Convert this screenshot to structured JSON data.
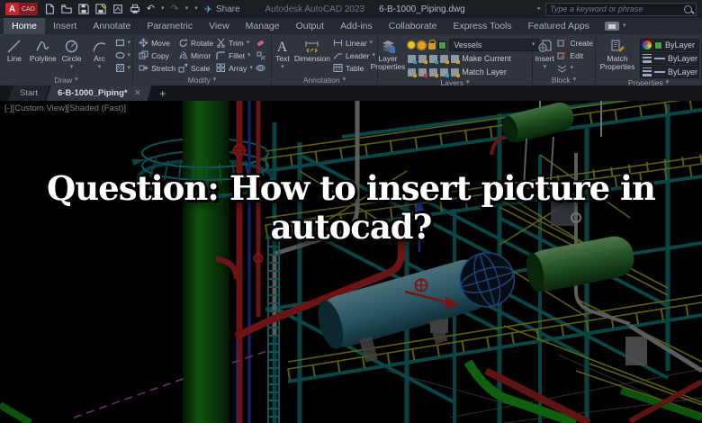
{
  "title_bar": {
    "logo_a": "A",
    "logo_cad": "CAD",
    "app_title": "Autodesk AutoCAD 2023",
    "doc_title": "6-B-1000_Piping.dwg",
    "share_label": "Share",
    "search_placeholder": "Type a keyword or phrase"
  },
  "glyphs": {
    "caret_down": "▾",
    "caret_right": "▸",
    "undo": "↶",
    "redo": "↷",
    "share_plane": "✈",
    "close": "✕",
    "plus": "+"
  },
  "ribbon": {
    "tabs": [
      {
        "label": "Home",
        "active": true
      },
      {
        "label": "Insert"
      },
      {
        "label": "Annotate"
      },
      {
        "label": "Parametric"
      },
      {
        "label": "View"
      },
      {
        "label": "Manage"
      },
      {
        "label": "Output"
      },
      {
        "label": "Add-ins"
      },
      {
        "label": "Collaborate"
      },
      {
        "label": "Express Tools"
      },
      {
        "label": "Featured Apps"
      }
    ],
    "draw": {
      "label": "Draw",
      "tools": [
        {
          "label": "Line"
        },
        {
          "label": "Polyline"
        },
        {
          "label": "Circle"
        },
        {
          "label": "Arc"
        }
      ]
    },
    "modify": {
      "label": "Modify",
      "col1": [
        "Move",
        "Copy",
        "Stretch"
      ],
      "col2": [
        "Rotate",
        "Mirror",
        "Scale"
      ],
      "col3": [
        "Trim",
        "Fillet",
        "Array"
      ]
    },
    "annotation": {
      "label": "Annotation",
      "text_label": "Text",
      "dimension_label": "Dimension",
      "rows": [
        "Linear",
        "Leader",
        "Table"
      ]
    },
    "layers": {
      "label": "Layers",
      "layer_properties_1": "Layer",
      "layer_properties_2": "Properties",
      "current_layer": "Vessels",
      "make_current": "Make Current",
      "match_layer": "Match Layer"
    },
    "block": {
      "label": "Block",
      "insert_label": "Insert",
      "rows": [
        "Create",
        "Edit"
      ]
    },
    "properties": {
      "label": "Properties",
      "match_1": "Match",
      "match_2": "Properties",
      "color_value": "ByLayer",
      "lineweight_value": "ByLayer",
      "linetype_value": "ByLayer"
    }
  },
  "file_tabs": {
    "start_label": "Start",
    "doc_label": "6-B-1000_Piping*"
  },
  "viewport": {
    "controls": {
      "minimize": "[-]",
      "view": "[Custom View]",
      "visual_style": "[Shaded (Fast)]"
    }
  },
  "overlay": {
    "line1": "Question: How to insert picture in",
    "line2": "autocad?"
  },
  "colors": {
    "current_layer_swatch": "#4a9e4a",
    "brand_red": "#c8242c",
    "structure_teal": "#117575",
    "structure_yellow": "#a8a81a",
    "pipe_red": "#b52222",
    "column_green": "#1c8c1c",
    "vessel_cyan": "#4690a6",
    "vessel_green": "#35863a",
    "headline_text": "#ffffff"
  }
}
